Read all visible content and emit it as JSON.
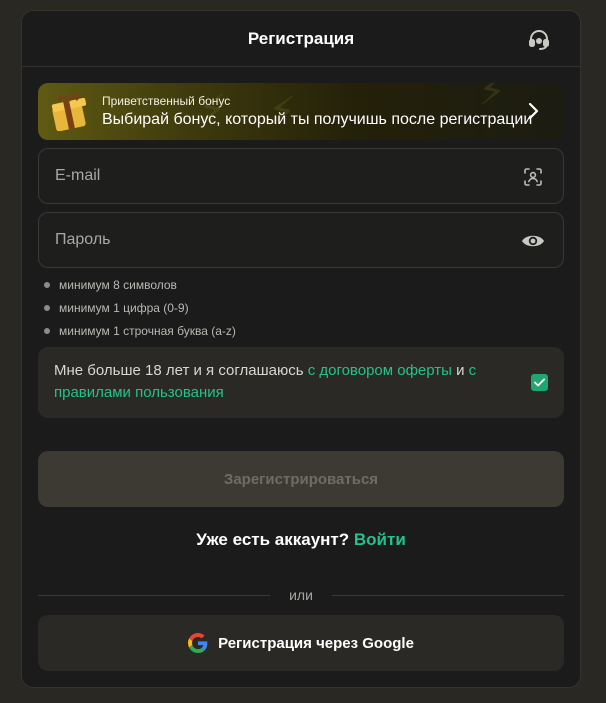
{
  "modal": {
    "title": "Регистрация",
    "support_icon": "headset-icon"
  },
  "bonus": {
    "small_text": "Приветственный бонус",
    "main_text": "Выбирай бонус, который ты получишь после регистрации",
    "icon": "gift-icon",
    "arrow_icon": "chevron-right-icon"
  },
  "email": {
    "placeholder": "E-mail",
    "value": "",
    "icon": "face-scan-icon"
  },
  "password": {
    "placeholder": "Пароль",
    "value": "",
    "icon": "eye-icon"
  },
  "requirements": [
    "минимум 8 символов",
    "минимум 1 цифра (0-9)",
    "минимум 1 строчная буква (a-z)"
  ],
  "agreement": {
    "text_before": "Мне больше 18 лет и я соглашаюсь ",
    "link1": "с договором оферты",
    "text_middle": " и ",
    "link2": "с правилами пользования",
    "checked": true
  },
  "register_button": "Зарегистрироваться",
  "login": {
    "text": "Уже есть аккаунт?",
    "link": "Войти"
  },
  "divider_text": "или",
  "google_button": "Регистрация через Google",
  "colors": {
    "accent_green": "#24c28a",
    "checkbox_green": "#1fa672",
    "background": "#1b1b1b"
  }
}
